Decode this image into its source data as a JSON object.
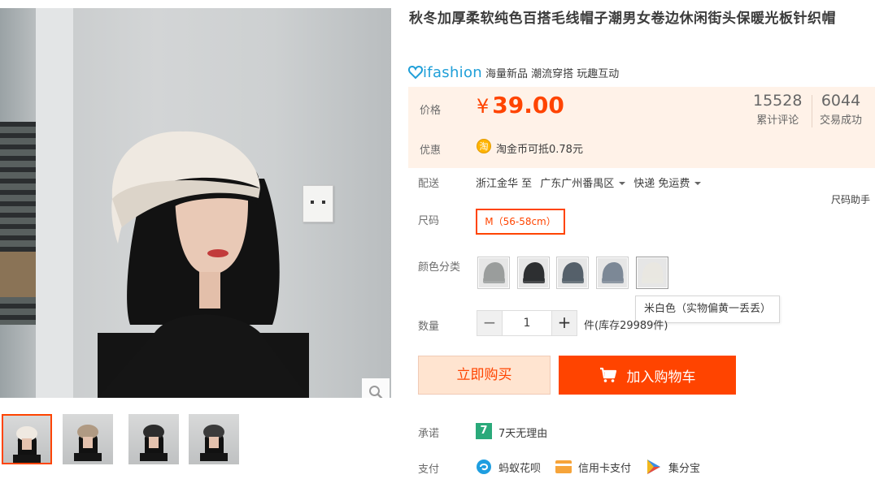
{
  "gallery": {
    "zoom_icon": "magnifier-icon",
    "thumbnails": [
      "thumbnail-1",
      "thumbnail-2",
      "thumbnail-3",
      "thumbnail-4"
    ]
  },
  "product": {
    "title": "秋冬加厚柔软纯色百搭毛线帽子潮男女卷边休闲街头保暖光板针织帽"
  },
  "brand": {
    "logo_text": "ifashion",
    "tagline": "海量新品 潮流穿搭 玩趣互动"
  },
  "price_panel": {
    "price_label": "价格",
    "currency": "¥",
    "price": "39.00",
    "reviews_count": "15528",
    "reviews_label": "累计评论",
    "deals_count": "6044",
    "deals_label": "交易成功",
    "promo_label": "优惠",
    "coin_char": "淘",
    "promo_text": "淘金币可抵0.78元"
  },
  "shipping": {
    "label": "配送",
    "from": "浙江金华 至",
    "to": "广东广州番禺区",
    "method": "快递 免运费"
  },
  "size": {
    "label": "尺码",
    "selected": "M（56-58cm）",
    "helper": "尺码助手"
  },
  "colors": {
    "label": "颜色分类",
    "swatches": [
      "#9a9d9c",
      "#2d2f31",
      "#55606a",
      "#7c8896",
      "#e9e7e1"
    ],
    "tooltip": "米白色（实物偏黄一丢丢）"
  },
  "quantity": {
    "label": "数量",
    "minus": "−",
    "value": "1",
    "plus": "+",
    "stock_text": "件(库存29989件)"
  },
  "actions": {
    "buy_now": "立即购买",
    "add_to_cart": "加入购物车"
  },
  "promise": {
    "label": "承诺",
    "icon_char": "7",
    "text": "7天无理由"
  },
  "payment": {
    "label": "支付",
    "methods": [
      "蚂蚁花呗",
      "信用卡支付",
      "集分宝"
    ]
  },
  "colors_theme": {
    "accent": "#ff4400",
    "price_bg": "#fff2e8",
    "brand_blue": "#1f9fd8"
  }
}
